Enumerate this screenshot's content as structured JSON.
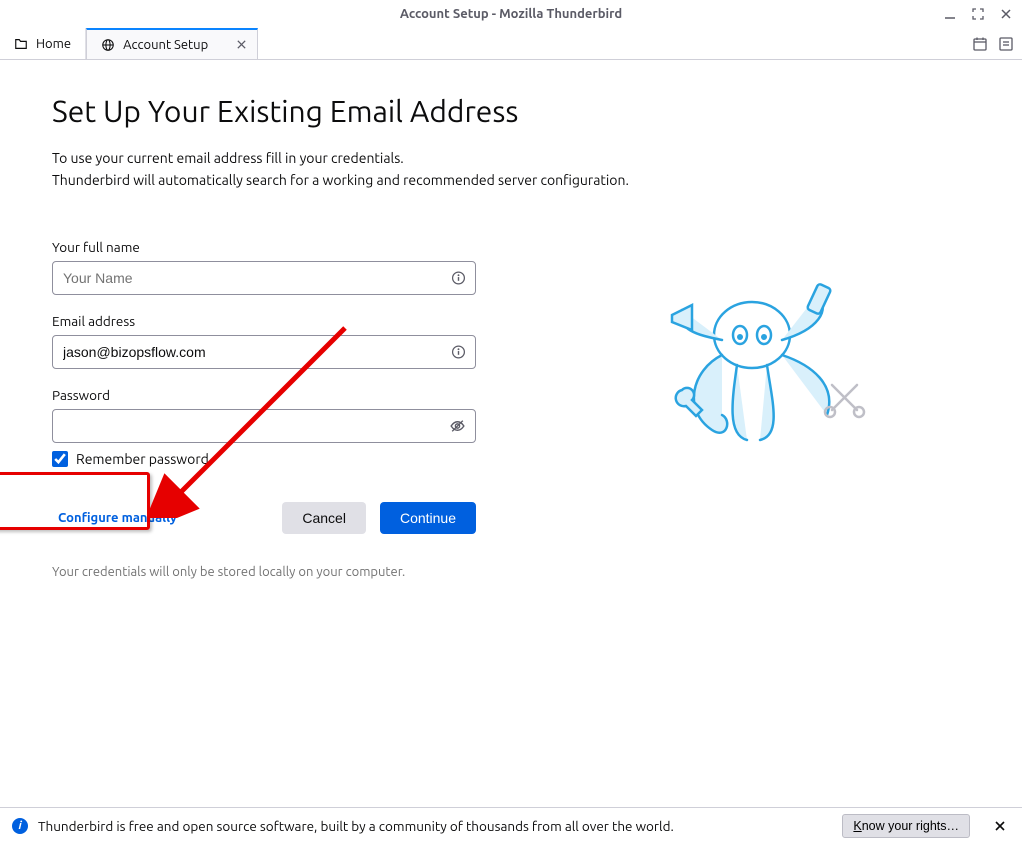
{
  "window": {
    "title": "Account Setup - Mozilla Thunderbird"
  },
  "tabs": {
    "home": "Home",
    "setup": "Account Setup"
  },
  "page": {
    "heading": "Set Up Your Existing Email Address",
    "subtitle_line1": "To use your current email address fill in your credentials.",
    "subtitle_line2": "Thunderbird will automatically search for a working and recommended server configuration."
  },
  "form": {
    "name_label": "Your full name",
    "name_placeholder": "Your Name",
    "name_value": "",
    "email_label": "Email address",
    "email_value": "jason@bizopsflow.com",
    "password_label": "Password",
    "password_value": "",
    "remember_label": "Remember password",
    "remember_checked": true
  },
  "buttons": {
    "configure": "Configure manually",
    "cancel": "Cancel",
    "continue": "Continue"
  },
  "privacy": "Your credentials will only be stored locally on your computer.",
  "notification": {
    "text": "Thunderbird is free and open source software, built by a community of thousands from all over the world.",
    "button": "Know your rights…"
  }
}
